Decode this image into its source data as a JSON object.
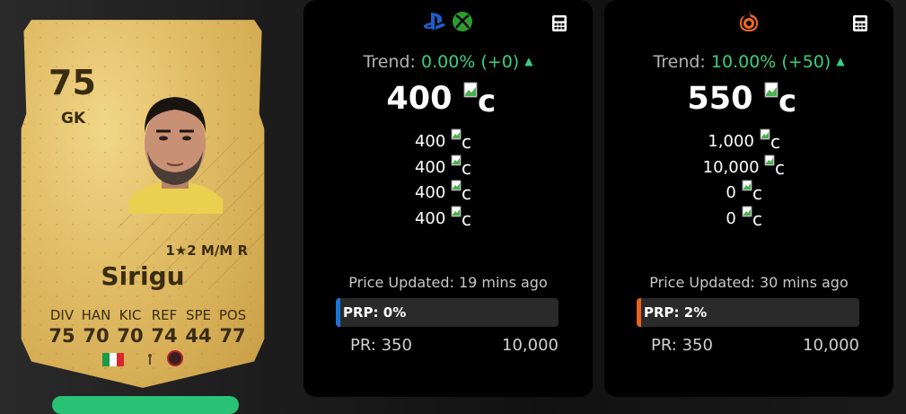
{
  "player": {
    "rating": "75",
    "position": "GK",
    "sub_stats": "1★2 M/M R",
    "name": "Sirigu",
    "stat_labels": [
      "DIV",
      "HAN",
      "KIC",
      "REF",
      "SPE",
      "POS"
    ],
    "stat_values": [
      "75",
      "70",
      "70",
      "74",
      "44",
      "77"
    ],
    "nation": "italy-flag-icon",
    "league": "league-icon",
    "club": "club-badge-icon"
  },
  "panels": [
    {
      "platform_icons": [
        "playstation-icon",
        "xbox-icon"
      ],
      "trend_label": "Trend:",
      "trend_value": "0.00% (+0)",
      "main_price": "400",
      "coin_alt": "c",
      "prices": [
        "400",
        "400",
        "400",
        "400"
      ],
      "updated": "Price Updated: 19 mins ago",
      "prp_label": "PRP: 0%",
      "prp_value": 0.0,
      "pr_min": "PR: 350",
      "pr_max": "10,000",
      "accent": "#1e73d8"
    },
    {
      "platform_icons": [
        "origin-icon"
      ],
      "trend_label": "Trend:",
      "trend_value": "10.00% (+50)",
      "main_price": "550",
      "coin_alt": "c",
      "prices": [
        "1,000",
        "10,000",
        "0",
        "0"
      ],
      "updated": "Price Updated: 30 mins ago",
      "prp_label": "PRP: 2%",
      "prp_value": 0.02,
      "pr_min": "PR: 350",
      "pr_max": "10,000",
      "accent": "#e8621d"
    }
  ],
  "colors": {
    "trend_up": "#35d07f",
    "card_gold": "#e3c06a",
    "panel_bg": "#000000"
  }
}
